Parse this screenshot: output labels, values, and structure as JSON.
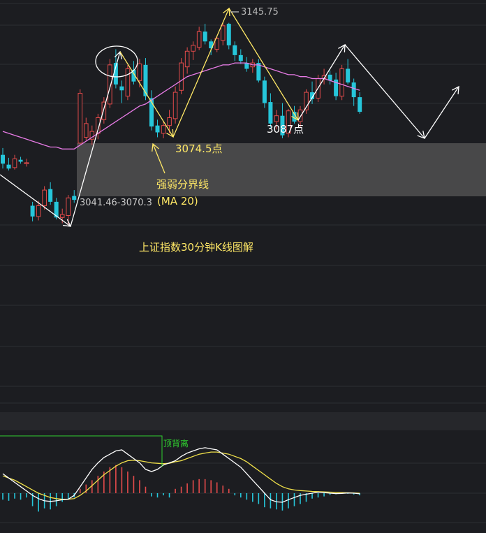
{
  "chart_data": [
    {
      "type": "candlestick",
      "annotations": {
        "high_value": "3145.75",
        "support_value": "3074.5点",
        "low_value": "3087点",
        "band_label": "3041.46-3070.3",
        "ma_line_label": "强弱分界线",
        "ma_line_sub": "(MA 20)",
        "caption": "上证指数30分钟K线图解"
      },
      "ohlc": [
        [
          3078.0,
          3081.5,
          3071.0,
          3073.5
        ],
        [
          3073.0,
          3076.5,
          3070.0,
          3071.0
        ],
        [
          3071.5,
          3078.0,
          3070.5,
          3076.0
        ],
        [
          3075.5,
          3077.0,
          3073.5,
          3074.5
        ],
        [
          3074.0,
          3076.0,
          3072.0,
          3074.0
        ],
        [
          3052.0,
          3054.0,
          3044.0,
          3046.5
        ],
        [
          3046.5,
          3054.5,
          3044.5,
          3052.0
        ],
        [
          3052.0,
          3062.0,
          3050.0,
          3060.0
        ],
        [
          3060.5,
          3064.0,
          3052.5,
          3054.0
        ],
        [
          3054.0,
          3056.0,
          3045.0,
          3046.0
        ],
        [
          3046.0,
          3050.5,
          3043.0,
          3047.5
        ],
        [
          3047.0,
          3057.5,
          3042.0,
          3056.0
        ],
        [
          3057.0,
          3060.0,
          3053.5,
          3055.0
        ],
        [
          3084.0,
          3111.5,
          3083.5,
          3109.5
        ],
        [
          3087.0,
          3097.0,
          3085.5,
          3094.0
        ],
        [
          3086.0,
          3093.0,
          3083.0,
          3090.0
        ],
        [
          3089.0,
          3099.0,
          3086.0,
          3097.0
        ],
        [
          3096.0,
          3107.5,
          3094.0,
          3105.0
        ],
        [
          3104.0,
          3127.0,
          3102.0,
          3124.0
        ],
        [
          3125.0,
          3132.0,
          3112.0,
          3114.0
        ],
        [
          3113.0,
          3116.0,
          3104.5,
          3111.0
        ],
        [
          3108.0,
          3124.0,
          3106.0,
          3122.0
        ],
        [
          3121.5,
          3126.0,
          3114.0,
          3115.5
        ],
        [
          3116.0,
          3127.0,
          3112.5,
          3124.5
        ],
        [
          3124.0,
          3127.5,
          3106.0,
          3108.0
        ],
        [
          3107.0,
          3111.0,
          3090.5,
          3092.5
        ],
        [
          3093.0,
          3096.0,
          3087.0,
          3089.5
        ],
        [
          3089.0,
          3095.0,
          3086.5,
          3093.0
        ],
        [
          3093.0,
          3101.0,
          3089.0,
          3097.0
        ],
        [
          3096.5,
          3113.0,
          3094.0,
          3110.0
        ],
        [
          3111.0,
          3127.5,
          3109.0,
          3125.0
        ],
        [
          3123.0,
          3133.0,
          3119.5,
          3131.0
        ],
        [
          3131.0,
          3136.0,
          3126.5,
          3134.0
        ],
        [
          3133.0,
          3143.5,
          3131.5,
          3141.0
        ],
        [
          3141.0,
          3145.0,
          3134.5,
          3136.0
        ],
        [
          3136.0,
          3137.0,
          3129.0,
          3132.5
        ],
        [
          3132.0,
          3138.5,
          3130.5,
          3137.5
        ],
        [
          3136.5,
          3145.75,
          3134.0,
          3144.0
        ],
        [
          3145.0,
          3145.5,
          3132.0,
          3134.0
        ],
        [
          3134.0,
          3136.0,
          3126.0,
          3129.0
        ],
        [
          3129.0,
          3132.0,
          3124.5,
          3126.0
        ],
        [
          3125.0,
          3128.0,
          3120.5,
          3122.0
        ],
        [
          3123.0,
          3127.0,
          3120.0,
          3125.0
        ],
        [
          3125.0,
          3127.0,
          3115.0,
          3116.0
        ],
        [
          3116.0,
          3118.0,
          3102.0,
          3104.5
        ],
        [
          3105.0,
          3109.5,
          3092.0,
          3094.0
        ],
        [
          3095.0,
          3101.0,
          3091.0,
          3098.0
        ],
        [
          3098.0,
          3104.5,
          3086.5,
          3088.0
        ],
        [
          3089.0,
          3101.5,
          3087.0,
          3100.5
        ],
        [
          3100.0,
          3103.0,
          3094.0,
          3095.0
        ],
        [
          3095.0,
          3103.0,
          3092.0,
          3101.0
        ],
        [
          3101.0,
          3111.5,
          3099.0,
          3110.0
        ],
        [
          3110.0,
          3115.5,
          3104.0,
          3106.5
        ],
        [
          3107.0,
          3119.0,
          3105.0,
          3117.0
        ],
        [
          3117.0,
          3122.0,
          3114.0,
          3118.5
        ],
        [
          3119.0,
          3121.0,
          3114.0,
          3116.0
        ],
        [
          3116.5,
          3120.0,
          3106.0,
          3108.0
        ],
        [
          3108.0,
          3124.0,
          3106.0,
          3122.0
        ],
        [
          3122.0,
          3127.0,
          3114.0,
          3115.0
        ],
        [
          3115.0,
          3117.0,
          3103.0,
          3107.5
        ],
        [
          3107.5,
          3110.0,
          3099.0,
          3100.0
        ]
      ],
      "ma20": [
        3090,
        3089,
        3088,
        3087,
        3086,
        3085,
        3084,
        3083,
        3082,
        3082,
        3081,
        3081,
        3081,
        3083,
        3085,
        3087,
        3089,
        3091,
        3093,
        3095,
        3097,
        3099,
        3101,
        3103,
        3104,
        3106,
        3108,
        3110,
        3112,
        3114,
        3116,
        3118,
        3119,
        3120,
        3121,
        3122,
        3123,
        3124,
        3124,
        3125,
        3125,
        3125,
        3124,
        3124,
        3123,
        3122,
        3121,
        3120,
        3119,
        3119,
        3118,
        3118,
        3117,
        3117,
        3117,
        3116,
        3115,
        3114,
        3113,
        3112,
        3111
      ],
      "macd_bars": [
        -3,
        -3.5,
        -2.5,
        -3,
        -2,
        -6,
        -8.5,
        -7,
        -7.5,
        -6,
        -4,
        -3,
        -2,
        2,
        4,
        6,
        8,
        10,
        12,
        13,
        12,
        10,
        8,
        6,
        3,
        -1.5,
        -2,
        -1,
        -2,
        2,
        3,
        4.5,
        6,
        6.5,
        6.5,
        6,
        5,
        3.5,
        2,
        -1,
        -2,
        -3,
        -4,
        -5,
        -6.5,
        -7,
        -7.5,
        -8,
        -7,
        -6,
        -5,
        -4,
        -2.5,
        -2,
        -1.5,
        -0.8,
        -0.5,
        0.5,
        -0.3,
        -0.6,
        -1
      ],
      "macd_dif": [
        9,
        7,
        5,
        3,
        1,
        -1,
        -2.5,
        -3.5,
        -3.8,
        -3.5,
        -3,
        -2.8,
        -1,
        3,
        7,
        11,
        14,
        16.5,
        18,
        19.5,
        20,
        18,
        16,
        14,
        11,
        10,
        11,
        13,
        14,
        15,
        17,
        18.5,
        19.5,
        20.5,
        21,
        20.5,
        20,
        18,
        16,
        14,
        12,
        9,
        6,
        3,
        0,
        -3,
        -4,
        -4.2,
        -3,
        -2,
        -1,
        -0.5,
        0,
        0.5,
        0.3,
        0,
        -0.2,
        -0.1,
        0.1,
        0,
        -0.3
      ],
      "macd_dea": [
        8,
        7,
        6,
        4.5,
        3,
        1.5,
        0,
        -1,
        -2,
        -2.5,
        -2.8,
        -2.8,
        -2.5,
        -1,
        1,
        3.5,
        6,
        8.5,
        10.5,
        12.5,
        14,
        15,
        15.2,
        15,
        14.5,
        14,
        13.8,
        13.6,
        13.8,
        14.5,
        15,
        16,
        17,
        18,
        18.5,
        19,
        19,
        18.5,
        18,
        17,
        16,
        14.5,
        12.5,
        10.5,
        8.5,
        6.5,
        4.5,
        3,
        2,
        1.5,
        1.2,
        1,
        0.8,
        0.7,
        0.6,
        0.5,
        0.4,
        0.3,
        0.2,
        0.1,
        0
      ],
      "macd_annotation": "顶背离",
      "colors": {
        "up": "#e54b4b",
        "down": "#26c6da",
        "ma": "#e87be6",
        "dif": "#ffffff",
        "dea": "#f2e24a",
        "annotation": "#ffe866",
        "divergence": "#2fd12f"
      }
    }
  ]
}
